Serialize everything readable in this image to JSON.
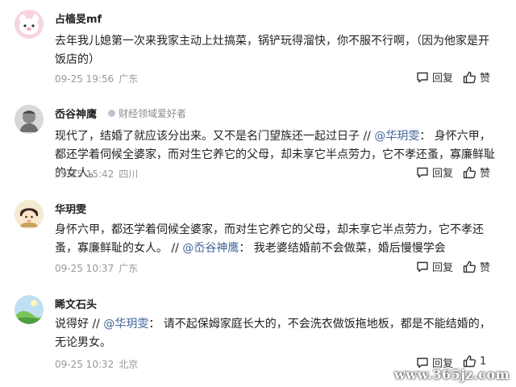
{
  "comments": [
    {
      "username": "占樯旻mf",
      "badge": "",
      "segments": [
        {
          "text": "去年我儿媳第一次来我家主动上灶搞菜，锅铲玩得溜快，你不服不行啊，（因为他家是开饭店的）",
          "mention": false
        }
      ],
      "time": "09-25 19:56",
      "location": "广东",
      "reply_label": "回复",
      "like_label": "赞"
    },
    {
      "username": "岙谷神鹰",
      "badge": "财经领域爱好者",
      "segments": [
        {
          "text": "现代了，结婚了就应该分出来。又不是名门望族还一起过日子 // ",
          "mention": false
        },
        {
          "text": "@华玥雯",
          "mention": true
        },
        {
          "text": "： 身怀六甲，都还学着伺候全婆家，而对生它养它的父母，却未享它半点劳力，它不孝还蚤，寡廉鲜耻的女人。",
          "mention": false
        }
      ],
      "time": "09-25 15:42",
      "location": "四川",
      "reply_label": "回复",
      "like_label": "赞"
    },
    {
      "username": "华玥雯",
      "badge": "",
      "segments": [
        {
          "text": "身怀六甲，都还学着伺候全婆家，而对生它养它的父母，却未享它半点劳力，它不孝还蚤，寡廉鲜耻的女人。 // ",
          "mention": false
        },
        {
          "text": "@岙谷神鹰",
          "mention": true
        },
        {
          "text": "： 我老婆结婚前不会做菜，婚后慢慢学会",
          "mention": false
        }
      ],
      "time": "09-25 10:37",
      "location": "广东",
      "reply_label": "回复",
      "like_label": "赞"
    },
    {
      "username": "睎文石头",
      "badge": "",
      "segments": [
        {
          "text": "说得好 // ",
          "mention": false
        },
        {
          "text": "@华玥雯",
          "mention": true
        },
        {
          "text": "： 请不起保姆家庭长大的，不会洗衣做饭拖地板，都是不能结婚的，无论男女。",
          "mention": false
        }
      ],
      "time": "09-25 10:32",
      "location": "北京",
      "reply_label": "回复",
      "like_label": "1"
    }
  ],
  "watermark": "www.365jz.com",
  "colors": {
    "mention": "#406599",
    "meta": "#999999",
    "background": "#ffffff"
  },
  "icons": {
    "reply": "speech-bubble-icon",
    "like": "thumbs-up-icon"
  }
}
